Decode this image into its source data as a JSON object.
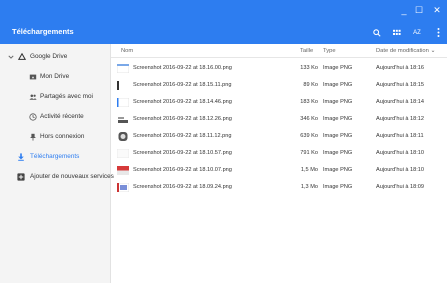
{
  "window": {
    "minimize": "_",
    "maximize": "☐",
    "close": "✕"
  },
  "appbar": {
    "title": "Téléchargements",
    "sort_label": "AZ"
  },
  "sidebar": {
    "items": [
      {
        "label": "Google Drive"
      },
      {
        "label": "Mon Drive"
      },
      {
        "label": "Partagés avec moi"
      },
      {
        "label": "Activité récente"
      },
      {
        "label": "Hors connexion"
      },
      {
        "label": "Téléchargements"
      },
      {
        "label": "Ajouter de nouveaux services"
      }
    ]
  },
  "table": {
    "columns": {
      "name": "Nom",
      "size": "Taille",
      "type": "Type",
      "date": "Date de modification",
      "sort_indicator": "⌄"
    },
    "rows": [
      {
        "name": "Screenshot 2016-09-22 at 18.16.00.png",
        "size": "133 Ko",
        "type": "Image PNG",
        "date": "Aujourd'hui à 18:16"
      },
      {
        "name": "Screenshot 2016-09-22 at 18.15.11.png",
        "size": "89 Ko",
        "type": "Image PNG",
        "date": "Aujourd'hui à 18:15"
      },
      {
        "name": "Screenshot 2016-09-22 at 18.14.46.png",
        "size": "183 Ko",
        "type": "Image PNG",
        "date": "Aujourd'hui à 18:14"
      },
      {
        "name": "Screenshot 2016-09-22 at 18.12.26.png",
        "size": "346 Ko",
        "type": "Image PNG",
        "date": "Aujourd'hui à 18:12"
      },
      {
        "name": "Screenshot 2016-09-22 at 18.11.12.png",
        "size": "639 Ko",
        "type": "Image PNG",
        "date": "Aujourd'hui à 18:11"
      },
      {
        "name": "Screenshot 2016-09-22 at 18.10.57.png",
        "size": "791 Ko",
        "type": "Image PNG",
        "date": "Aujourd'hui à 18:10"
      },
      {
        "name": "Screenshot 2016-09-22 at 18.10.07.png",
        "size": "1,5 Mo",
        "type": "Image PNG",
        "date": "Aujourd'hui à 18:10"
      },
      {
        "name": "Screenshot 2016-09-22 at 18.09.24.png",
        "size": "1,3 Mo",
        "type": "Image PNG",
        "date": "Aujourd'hui à 18:09"
      }
    ]
  },
  "colors": {
    "accent": "#2d7df0",
    "sidebar_bg": "#f4f4f4"
  }
}
